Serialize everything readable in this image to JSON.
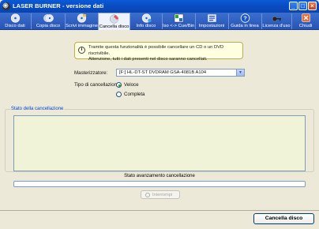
{
  "window": {
    "title": "LASER BURNER - versione dati",
    "controls": [
      "minimize",
      "maximize",
      "close"
    ]
  },
  "toolbar": {
    "items": [
      {
        "label": "Disco dati",
        "icon": "disc-data-icon"
      },
      {
        "label": "Copia disco",
        "icon": "copy-disc-icon"
      },
      {
        "label": "Scrivi immagine",
        "icon": "write-image-icon"
      },
      {
        "label": "Cancella disco",
        "icon": "erase-disc-icon",
        "active": true
      },
      {
        "label": "Info disco",
        "icon": "disc-info-icon"
      },
      {
        "label": "Iso <-> Cue/Bin",
        "icon": "iso-convert-icon"
      },
      {
        "label": "Impostazioni",
        "icon": "settings-icon"
      },
      {
        "label": "Guida in linea",
        "icon": "help-icon"
      },
      {
        "label": "Licenza d'uso",
        "icon": "license-icon"
      },
      {
        "label": "Chiudi",
        "icon": "close-icon"
      }
    ]
  },
  "info": {
    "line1": "Tramite questa funzionalità è possibile cancellare un CD o un DVD riscrivibile.",
    "line2": "Attenzione, tutti i dati presenti nel disco saranno cancellati."
  },
  "form": {
    "burner_label": "Masterizzatore:",
    "burner_value": "[F:] HL-DT-ST DVDRAM GSA-4081B A104",
    "erase_type_label": "Tipo di cancellazione:",
    "options": [
      {
        "label": "Veloce",
        "checked": true
      },
      {
        "label": "Completa",
        "checked": false
      }
    ]
  },
  "status": {
    "group_title": "Stato della cancellazione",
    "log_text": "",
    "progress_label": "Stato avanzamento cancellazione",
    "progress_value": 0,
    "stop_label": "Interrompi"
  },
  "footer": {
    "erase_button": "Cancella disco"
  },
  "colors": {
    "titlebar": "#0a4ec4",
    "toolbar": "#2853b4",
    "window_bg": "#ece9d8",
    "radio_dot": "#21a121",
    "group_title": "#0046d5",
    "log_bg": "#f0f3d8"
  }
}
